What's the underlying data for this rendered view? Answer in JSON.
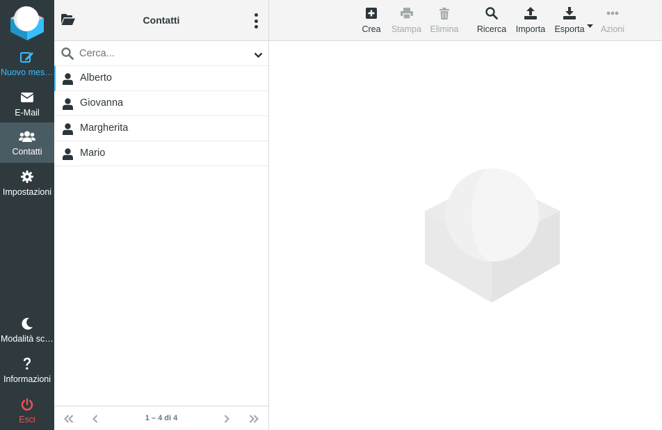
{
  "sidebar": {
    "items": [
      {
        "label": "Nuovo messaggio",
        "icon": "compose-icon"
      },
      {
        "label": "E-Mail",
        "icon": "envelope-icon"
      },
      {
        "label": "Contatti",
        "icon": "users-icon"
      },
      {
        "label": "Impostazioni",
        "icon": "gear-icon"
      },
      {
        "label": "Modalità scura",
        "icon": "moon-icon"
      },
      {
        "label": "Informazioni",
        "icon": "question-icon"
      },
      {
        "label": "Esci",
        "icon": "power-icon"
      }
    ],
    "active": "Contatti"
  },
  "list": {
    "title": "Contatti",
    "search_placeholder": "Cerca...",
    "contacts": [
      "Alberto",
      "Giovanna",
      "Margherita",
      "Mario"
    ],
    "pagination": "1 – 4 di 4"
  },
  "toolbar": {
    "create": "Crea",
    "print": "Stampa",
    "delete": "Elimina",
    "search": "Ricerca",
    "import": "Importa",
    "export": "Esporta",
    "actions": "Azioni"
  },
  "colors": {
    "sidebar_bg": "#2f3a3f",
    "sidebar_active": "#4a5c63",
    "accent": "#37beff",
    "logout": "#f15054"
  }
}
